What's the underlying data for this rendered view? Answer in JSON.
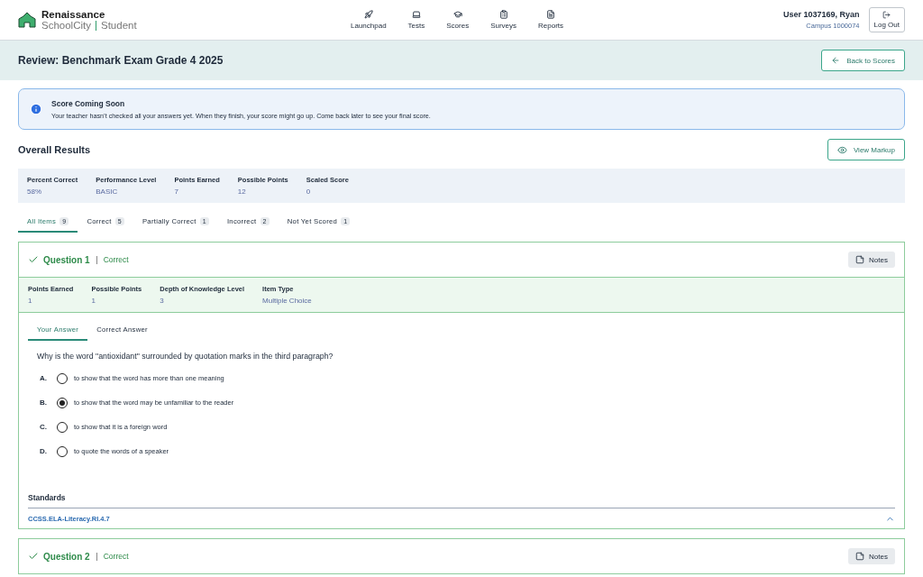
{
  "header": {
    "logo": {
      "brand": "Renaissance",
      "product": "SchoolCity",
      "area": "Student"
    },
    "nav": [
      {
        "kind": "rocket",
        "label": "Launchpad"
      },
      {
        "kind": "laptop",
        "label": "Tests"
      },
      {
        "kind": "grade",
        "label": "Scores"
      },
      {
        "kind": "clipboard",
        "label": "Surveys"
      },
      {
        "kind": "file",
        "label": "Reports"
      }
    ],
    "user": {
      "name": "User 1037169, Ryan",
      "campus": "Campus 1000074"
    },
    "logout": "Log Out"
  },
  "title_bar": {
    "title": "Review: Benchmark Exam Grade 4 2025",
    "back": "Back to Scores"
  },
  "alert": {
    "title": "Score Coming Soon",
    "message": "Your teacher hasn’t checked all your answers yet. When they finish, your score might go up. Come back later to see your final score."
  },
  "overall": {
    "title": "Overall Results",
    "button": "View Markup",
    "stats": [
      {
        "label": "Percent Correct",
        "value": "58%"
      },
      {
        "label": "Performance Level",
        "value": "BASIC"
      },
      {
        "label": "Points Earned",
        "value": "7"
      },
      {
        "label": "Possible Points",
        "value": "12"
      },
      {
        "label": "Scaled Score",
        "value": "0"
      }
    ]
  },
  "filter_tabs": [
    {
      "label": "All Items",
      "count": "9",
      "selected": true
    },
    {
      "label": "Correct",
      "count": "5",
      "selected": false
    },
    {
      "label": "Partially Correct",
      "count": "1",
      "selected": false
    },
    {
      "label": "Incorrect",
      "count": "2",
      "selected": false
    },
    {
      "label": "Not Yet Scored",
      "count": "1",
      "selected": false
    }
  ],
  "questions": [
    {
      "title": "Question 1",
      "correct": true,
      "status": "Correct",
      "notes": "Notes",
      "stats": [
        {
          "label": "Points Earned",
          "value": "1"
        },
        {
          "label": "Possible Points",
          "value": "1"
        },
        {
          "label": "Depth of Knowledge Level",
          "value": "3"
        },
        {
          "label": "Item Type",
          "value": "Multiple Choice"
        }
      ],
      "answer_tabs": [
        {
          "label": "Your Answer",
          "selected": true
        },
        {
          "label": "Correct Answer",
          "selected": false
        }
      ],
      "prompt": "Why is the word \"antioxidant\" surrounded by quotation marks in the third paragraph?",
      "choices": [
        {
          "letter": "A.",
          "text": "to show that the word has more than one meaning",
          "selected": false
        },
        {
          "letter": "B.",
          "text": "to show that the word may be unfamiliar to the reader",
          "selected": true
        },
        {
          "letter": "C.",
          "text": "to show that it is a foreign word",
          "selected": false
        },
        {
          "letter": "D.",
          "text": "to quote the words of a speaker",
          "selected": false
        }
      ],
      "standards_title": "Standards",
      "standard": "CCSS.ELA-Literacy.RI.4.7",
      "expanded": true
    },
    {
      "title": "Question 2",
      "correct": true,
      "status": "Correct",
      "notes": "Notes"
    }
  ]
}
